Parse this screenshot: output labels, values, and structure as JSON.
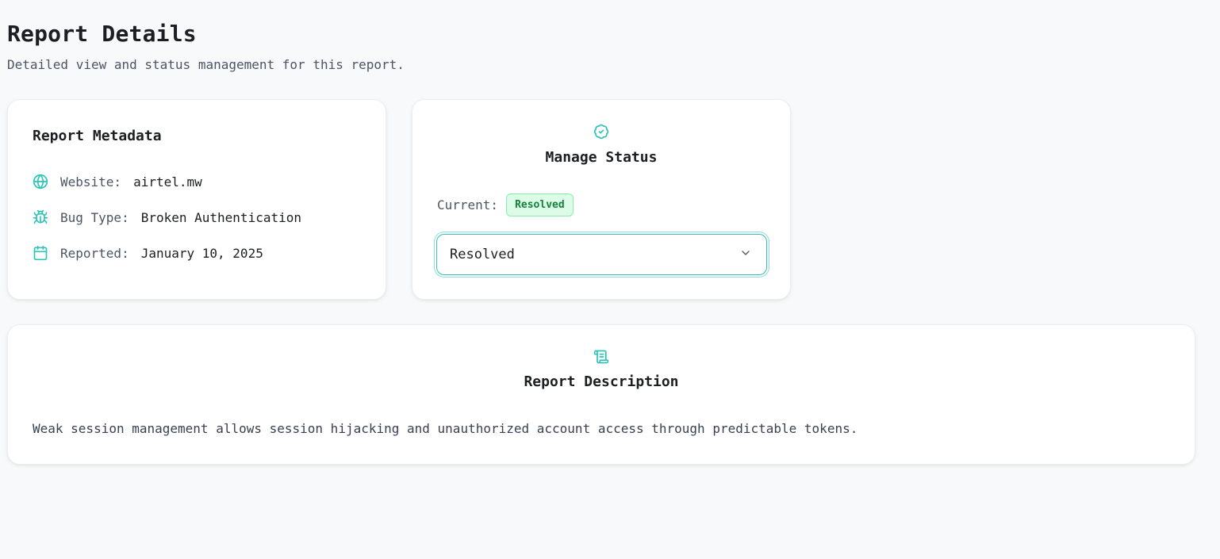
{
  "page": {
    "title": "Report Details",
    "subtitle": "Detailed view and status management for this report."
  },
  "metadata": {
    "heading": "Report Metadata",
    "website_label": "Website:",
    "website_value": "airtel.mw",
    "bug_type_label": "Bug Type:",
    "bug_type_value": "Broken Authentication",
    "reported_label": "Reported:",
    "reported_value": "January 10, 2025",
    "icons": [
      "globe-icon",
      "bug-icon",
      "calendar-icon"
    ]
  },
  "status": {
    "heading": "Manage Status",
    "current_label": "Current:",
    "current_badge": "Resolved",
    "selected_option": "Resolved",
    "icon": "badge-check-icon"
  },
  "description": {
    "heading": "Report Description",
    "text": "Weak session management allows session hijacking and unauthorized account access through predictable tokens.",
    "icon": "scroll-icon"
  },
  "colors": {
    "accent": "#2ec4b6",
    "badge_text": "#15803d",
    "badge_bg": "#dcfce7",
    "badge_border": "#86efac",
    "background": "#f8f9fb"
  }
}
